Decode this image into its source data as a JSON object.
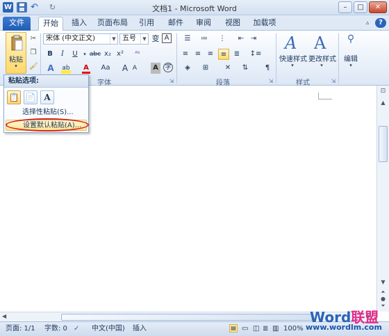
{
  "window": {
    "title": "文档1 - Microsoft Word",
    "win_minimize": "–",
    "win_maximize": "□",
    "win_close": "✕"
  },
  "quick_access": {
    "word_icon": "W",
    "save_icon": "💾",
    "undo_icon": "↶",
    "redo_icon": "↻"
  },
  "tabs": [
    {
      "label": "文件"
    },
    {
      "label": "开始"
    },
    {
      "label": "插入"
    },
    {
      "label": "页面布局"
    },
    {
      "label": "引用"
    },
    {
      "label": "邮件"
    },
    {
      "label": "审阅"
    },
    {
      "label": "视图"
    },
    {
      "label": "加载项"
    }
  ],
  "ribbon": {
    "paste_label": "粘贴",
    "font_name": "宋体 (中文正文)",
    "font_size": "五号",
    "bold": "B",
    "italic": "I",
    "underline": "U",
    "strike": "abc",
    "subscript": "x₂",
    "superscript": "x²",
    "font_color": "A",
    "aa_case": "Aa",
    "grow_font": "A",
    "shrink_font": "A",
    "group_font": "字体",
    "group_paragraph": "段落",
    "group_styles": "样式",
    "quick_styles": "快速样式",
    "change_styles": "更改样式",
    "edit_label": "编辑"
  },
  "paste_popup": {
    "header": "粘贴选项:",
    "item_special": "选择性粘贴(S)...",
    "item_default": "设置默认粘贴(A)..."
  },
  "status": {
    "page": "页面: 1/1",
    "words": "字数: 0",
    "language": "中文(中国)",
    "mode": "插入",
    "zoom": "100%"
  },
  "watermark": {
    "text_word": "Word",
    "text_union": "联盟",
    "url": "www.wordlm.com"
  },
  "colors": {
    "accent": "#2b63b8",
    "ribbon": "#dce7f5",
    "highlight": "#ffe596",
    "oval": "#d02a1a"
  }
}
